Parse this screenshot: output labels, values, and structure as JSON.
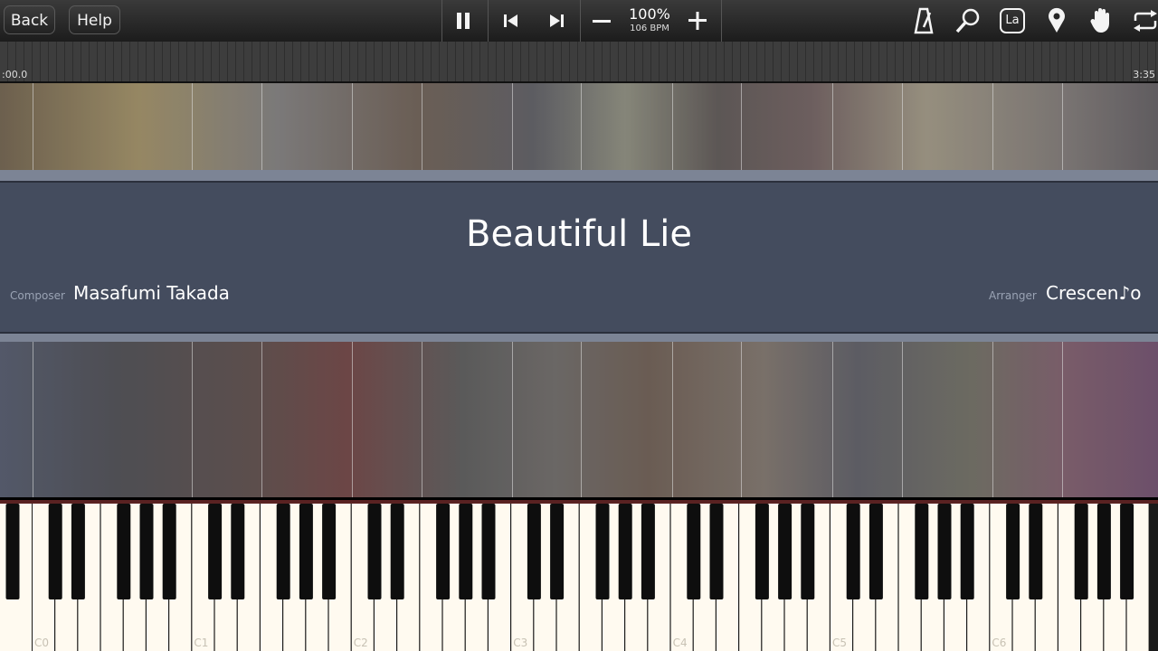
{
  "toolbar": {
    "back_label": "Back",
    "help_label": "Help",
    "speed": "100%",
    "bpm": "106 BPM",
    "icons": [
      "pause-icon",
      "skip-back-icon",
      "skip-forward-icon",
      "minus-icon",
      "plus-icon",
      "metronome-icon",
      "search-icon",
      "label-icon",
      "location-pin-icon",
      "hand-icon",
      "loop-icon"
    ],
    "label_icon_text": "La"
  },
  "timeline": {
    "start_time": ":00.0",
    "end_time": "3:35"
  },
  "song": {
    "title": "Beautiful Lie",
    "composer_label": "Composer",
    "composer": "Masafumi Takada",
    "arranger_label": "Arranger",
    "arranger": "Crescen♪o"
  },
  "keyboard": {
    "octave_labels": [
      "C0",
      "C1",
      "C2",
      "C3",
      "C4",
      "C5",
      "C6"
    ]
  },
  "colors": {
    "panel": "#444c5e",
    "panel_border": "#7c8495",
    "white_key": "#fffaf0",
    "black_key": "#0e0e0e"
  }
}
